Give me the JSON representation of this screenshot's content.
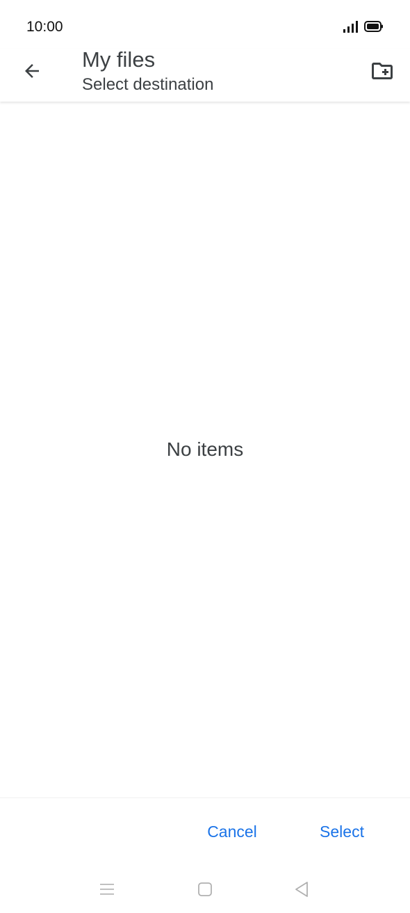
{
  "status_bar": {
    "time": "10:00",
    "icons": [
      "signal-icon",
      "battery-icon"
    ]
  },
  "app_bar": {
    "title": "My files",
    "subtitle": "Select destination",
    "back_icon": "arrow-back-icon",
    "new_folder_icon": "create-new-folder-icon"
  },
  "content": {
    "empty_text": "No items"
  },
  "actions": {
    "cancel_label": "Cancel",
    "select_label": "Select"
  },
  "nav_bar": {
    "items": [
      "menu-icon",
      "home-square-icon",
      "back-triangle-icon"
    ]
  },
  "colors": {
    "accent": "#1a73e8",
    "text": "#3c4043",
    "background": "#ffffff"
  }
}
